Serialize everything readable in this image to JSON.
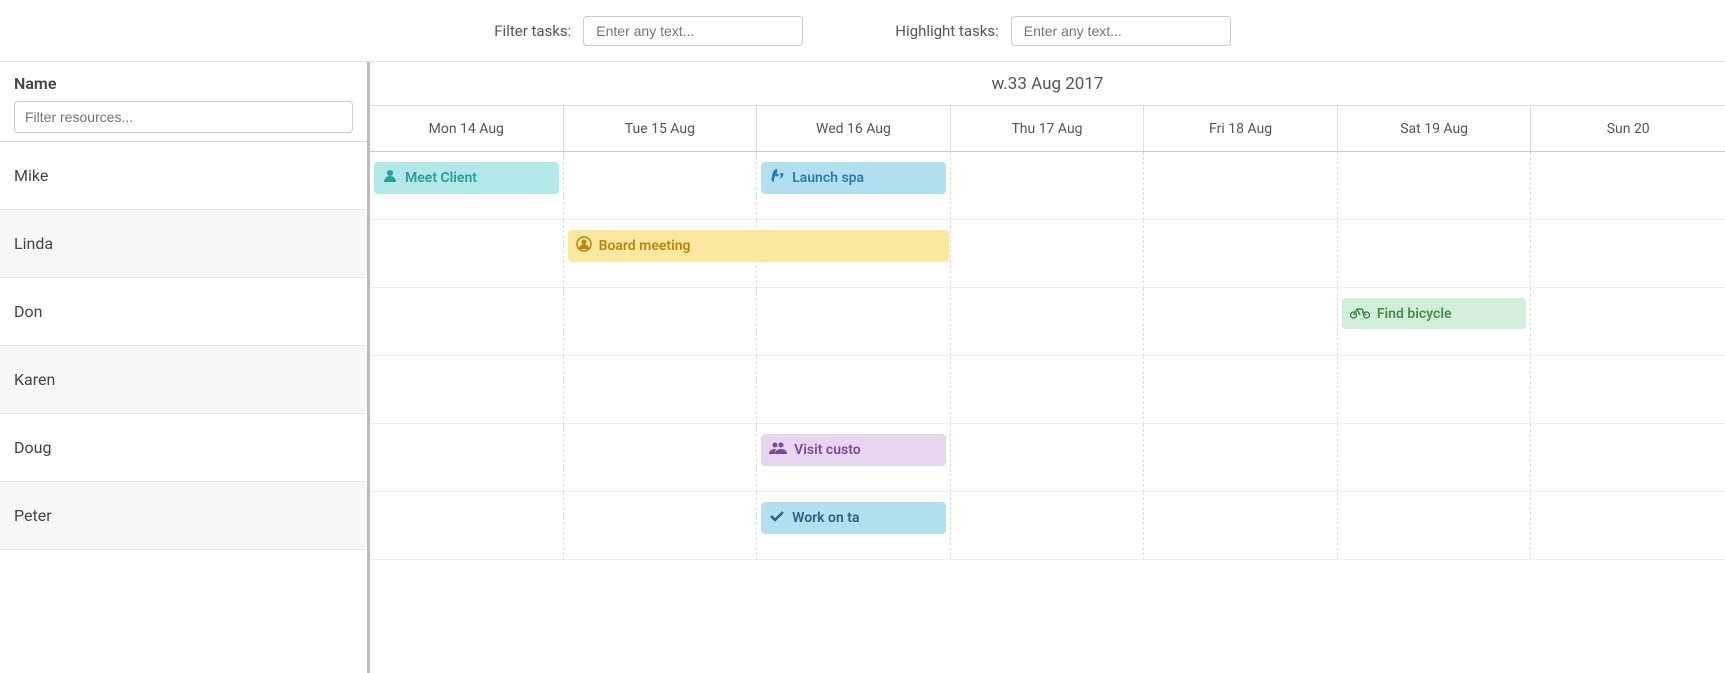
{
  "toolbar": {
    "filter_tasks_label": "Filter tasks:",
    "filter_tasks_placeholder": "Enter any text...",
    "highlight_tasks_label": "Highlight tasks:",
    "highlight_tasks_placeholder": "Enter any text..."
  },
  "sidebar": {
    "name_label": "Name",
    "filter_placeholder": "Filter resources...",
    "resources": [
      {
        "id": "mike",
        "name": "Mike"
      },
      {
        "id": "linda",
        "name": "Linda"
      },
      {
        "id": "don",
        "name": "Don"
      },
      {
        "id": "karen",
        "name": "Karen"
      },
      {
        "id": "doug",
        "name": "Doug"
      },
      {
        "id": "peter",
        "name": "Peter"
      }
    ]
  },
  "calendar": {
    "week_label": "w.33 Aug 2017",
    "days": [
      {
        "label": "Mon 14 Aug"
      },
      {
        "label": "Tue 15 Aug"
      },
      {
        "label": "Wed 16 Aug"
      },
      {
        "label": "Thu 17 Aug"
      },
      {
        "label": "Fri 18 Aug"
      },
      {
        "label": "Sat 19 Aug"
      },
      {
        "label": "Sun 20"
      }
    ],
    "tasks": [
      {
        "id": "meet-client",
        "resource": "mike",
        "day": 0,
        "text": "Meet Client",
        "color": "teal",
        "icon": "person"
      },
      {
        "id": "launch-spa",
        "resource": "mike",
        "day": 2,
        "text": "Launch spa",
        "color": "blue",
        "icon": "rocket"
      },
      {
        "id": "board-meeting",
        "resource": "linda",
        "day": 1,
        "text": "Board meeting",
        "color": "yellow",
        "icon": "person-circle",
        "span": 2
      },
      {
        "id": "find-bicycle",
        "resource": "don",
        "day": 5,
        "text": "Find bicycle",
        "color": "green",
        "icon": "bicycle"
      },
      {
        "id": "visit-customer",
        "resource": "doug",
        "day": 2,
        "text": "Visit custo",
        "color": "purple",
        "icon": "people"
      },
      {
        "id": "work-on-task",
        "resource": "peter",
        "day": 2,
        "text": "Work on ta",
        "color": "lightblue",
        "icon": "checkmark"
      }
    ]
  }
}
